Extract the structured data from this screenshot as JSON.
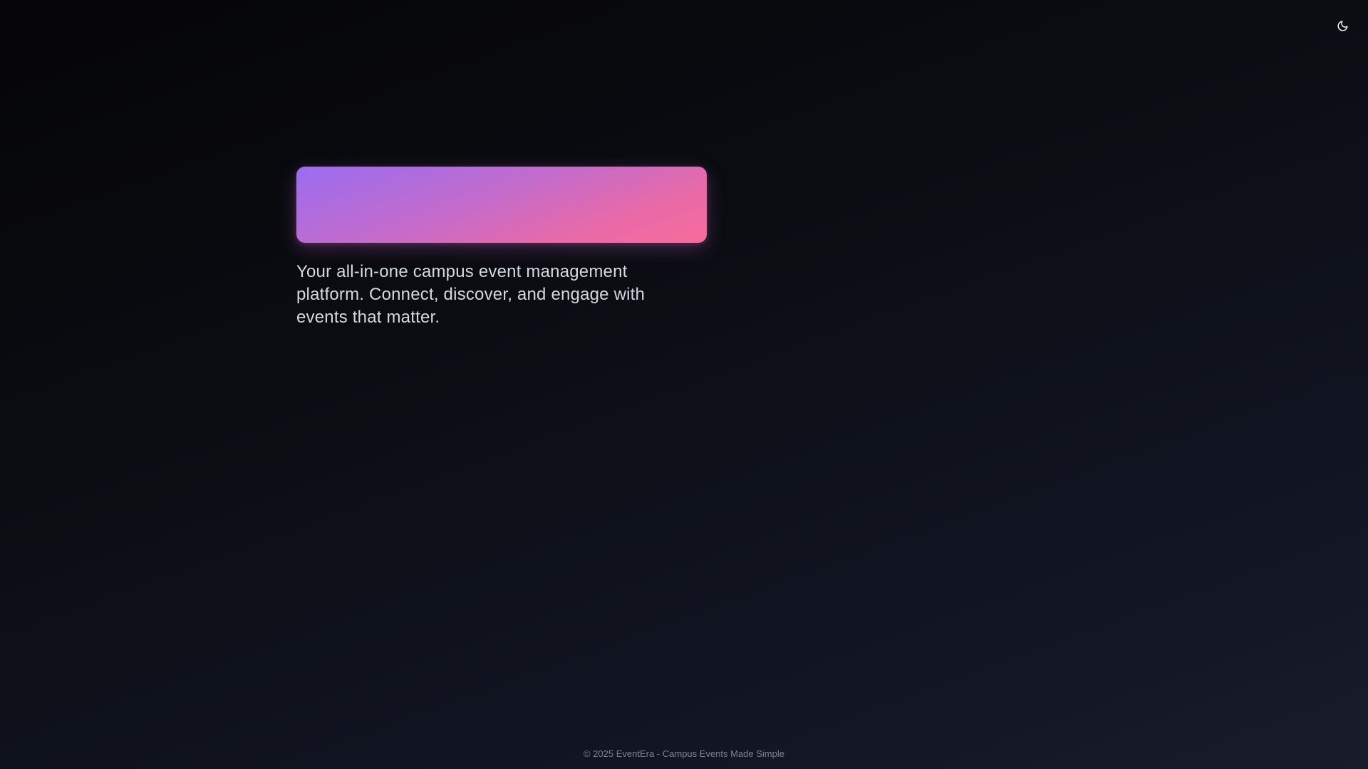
{
  "header": {
    "theme_toggle_icon": "moon-icon"
  },
  "hero": {
    "tagline": "Your all-in-one campus event management platform. Connect, discover, and engage with events that matter.",
    "banner_gradient": [
      "#9a6df0",
      "#f76c9b"
    ]
  },
  "footer": {
    "copyright": "© 2025 EventEra - Campus Events Made Simple"
  },
  "colors": {
    "background_dark": "#050507",
    "background_light": "#181c2b",
    "text_primary": "#d7d7de",
    "text_muted": "#80818d"
  }
}
